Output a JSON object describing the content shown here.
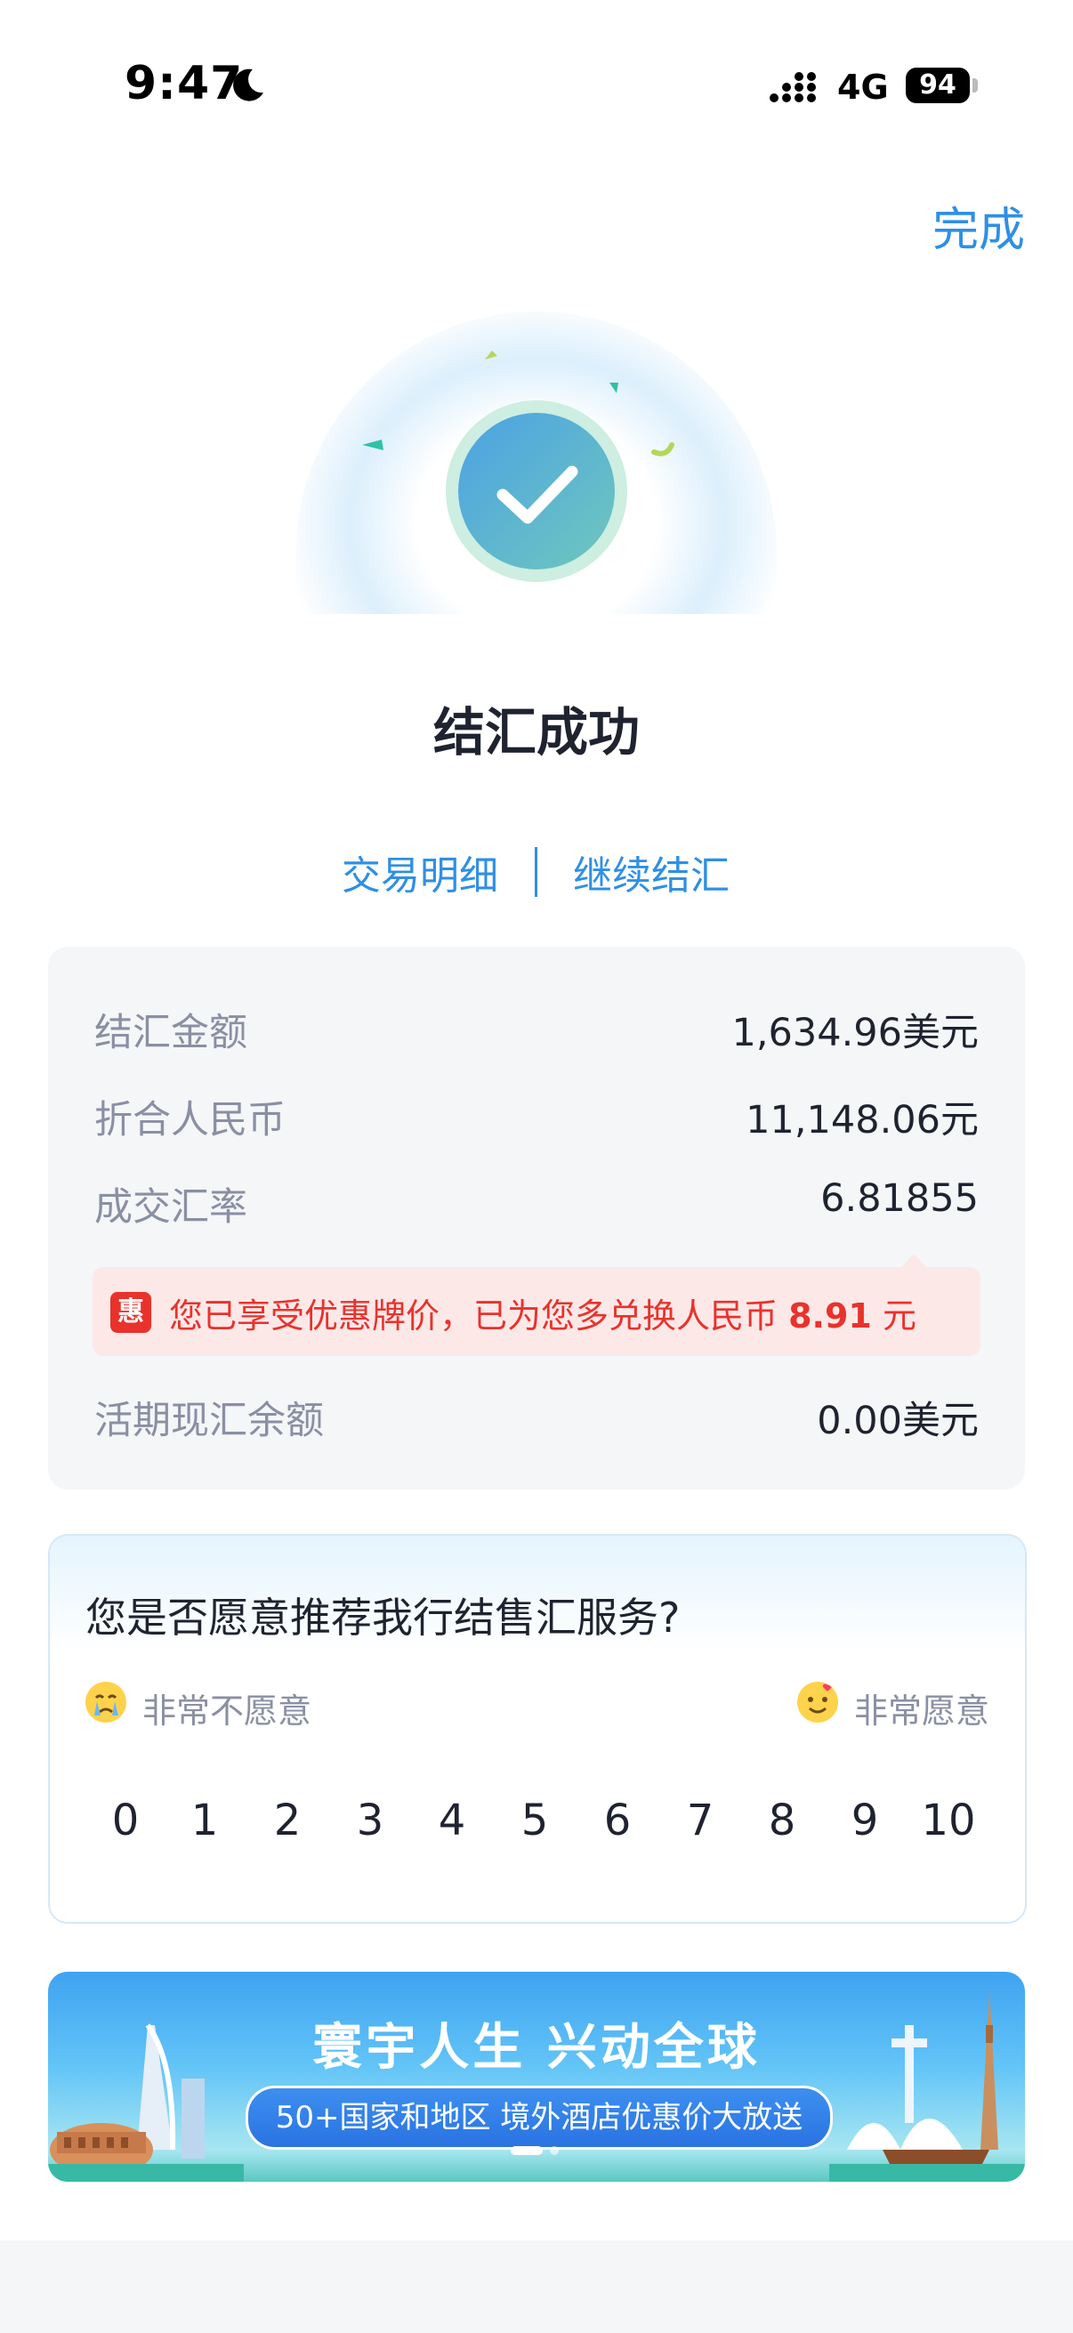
{
  "status_bar": {
    "time": "9:47",
    "network": "4G",
    "battery": "94"
  },
  "header": {
    "done_label": "完成"
  },
  "result": {
    "title": "结汇成功",
    "link_detail": "交易明细",
    "link_continue": "继续结汇"
  },
  "summary": {
    "rows": [
      {
        "label": "结汇金额",
        "value": "1,634.96美元"
      },
      {
        "label": "折合人民币",
        "value": "11,148.06元"
      },
      {
        "label": "成交汇率",
        "value": "6.81855"
      }
    ],
    "promo": {
      "icon_text": "惠",
      "text_before": "您已享受优惠牌价，已为您多兑换人民币 ",
      "amount": "8.91",
      "text_after": " 元"
    },
    "balance": {
      "label": "活期现汇余额",
      "value": "0.00美元"
    }
  },
  "survey": {
    "question": "您是否愿意推荐我行结售汇服务?",
    "low_label": "非常不愿意",
    "high_label": "非常愿意",
    "scale": [
      "0",
      "1",
      "2",
      "3",
      "4",
      "5",
      "6",
      "7",
      "8",
      "9",
      "10"
    ]
  },
  "banner": {
    "title": "寰宇人生 兴动全球",
    "subtitle": "50+国家和地区 境外酒店优惠价大放送"
  },
  "colors": {
    "accent": "#2f8fe5",
    "promo_red": "#e9322b",
    "muted": "#8a8fa3"
  }
}
